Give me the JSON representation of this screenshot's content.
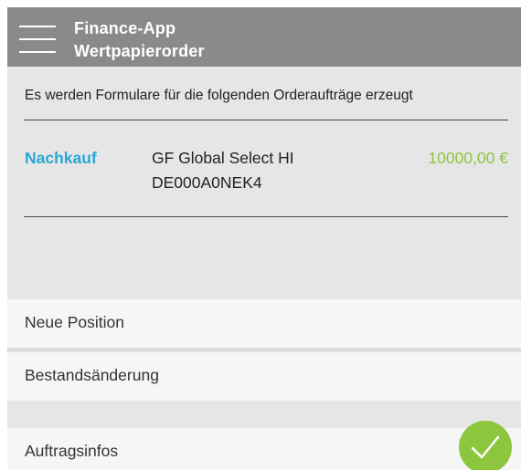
{
  "header": {
    "title": "Finance-App",
    "subtitle": "Wertpapierorder"
  },
  "summary": {
    "intro": "Es werden Formulare für die folgenden Orderaufträge erzeugt",
    "orders": [
      {
        "type": "Nachkauf",
        "name": "GF Global Select HI",
        "isin": "DE000A0NEK4",
        "amount": "10000,00 €"
      }
    ]
  },
  "menu": {
    "items": [
      {
        "label": "Neue Position"
      },
      {
        "label": "Bestandsänderung"
      },
      {
        "label": "Auftragsinfos"
      }
    ]
  },
  "icons": {
    "menu": "hamburger-menu-icon",
    "confirm": "checkmark-icon"
  },
  "colors": {
    "header_bg": "#8a8a8a",
    "accent_blue": "#2aa7d6",
    "accent_green": "#8cc63f",
    "panel_bg": "#e6e6e6"
  }
}
